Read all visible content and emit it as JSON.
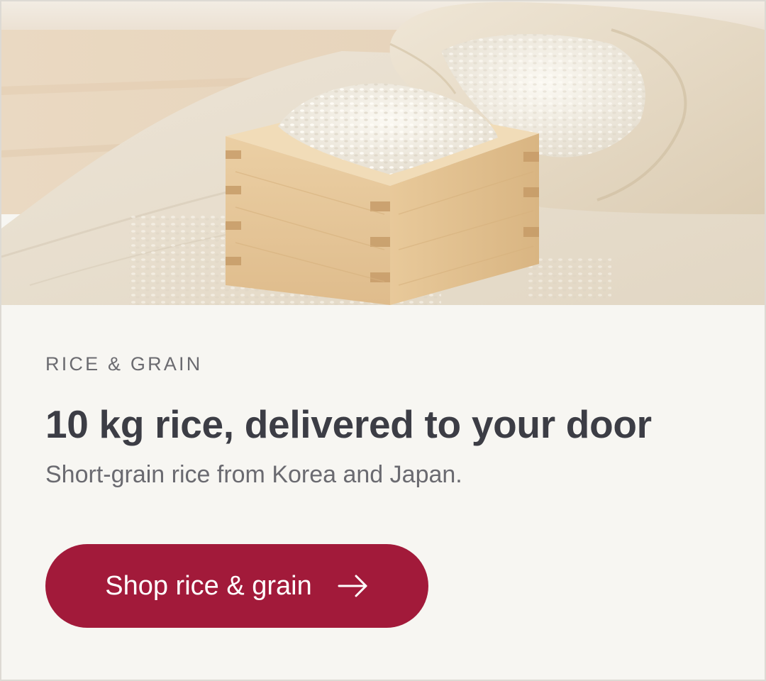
{
  "hero": {
    "image_alt": "Wooden masu box filled with rice beside an open linen sack of rice",
    "icon": "rice-masu-photo"
  },
  "promo": {
    "eyebrow": "RICE & GRAIN",
    "headline": "10 kg rice, delivered to your door",
    "subline": "Short-grain rice from Korea and Japan.",
    "cta_label": "Shop rice & grain",
    "cta_icon": "arrow-right-icon"
  },
  "colors": {
    "accent": "#a21a3a",
    "background": "#f7f6f2",
    "headline": "#3c3d45",
    "muted": "#6b6b70"
  }
}
